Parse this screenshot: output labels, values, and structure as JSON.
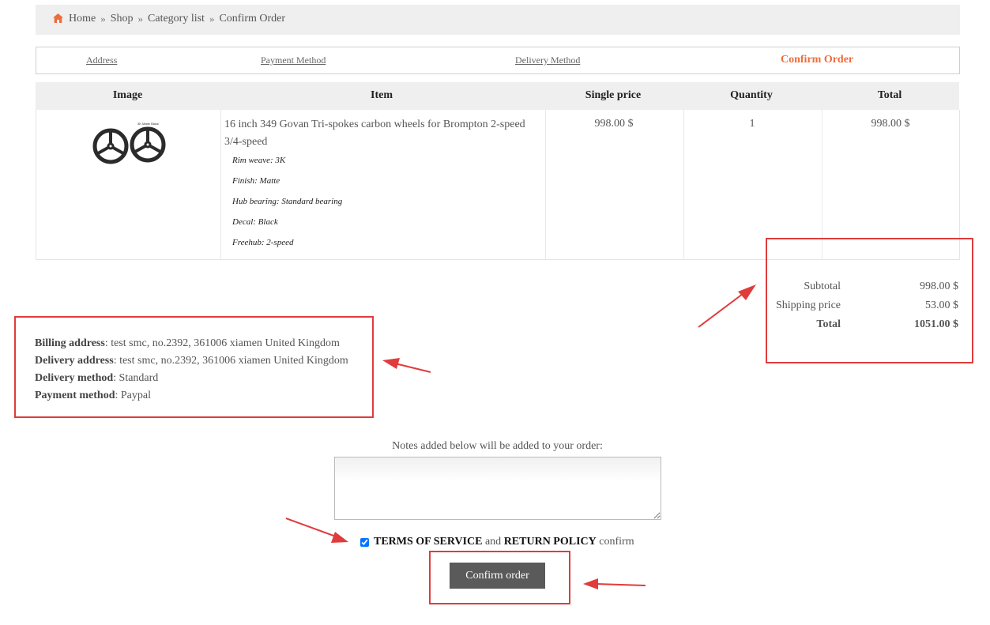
{
  "breadcrumb": {
    "items": [
      "Home",
      "Shop",
      "Category list",
      "Confirm Order"
    ],
    "separator": "»"
  },
  "steps": {
    "address": "Address",
    "payment": "Payment Method",
    "delivery": "Delivery Method",
    "confirm": "Confirm Order"
  },
  "table": {
    "headers": [
      "Image",
      "Item",
      "Single price",
      "Quantity",
      "Total"
    ],
    "row": {
      "image_caption": "3K Matte Black",
      "item_title": "16 inch 349 Govan Tri-spokes carbon wheels for Brompton 2-speed 3/4-speed",
      "options": [
        "Rim weave: 3K",
        "Finish: Matte",
        "Hub bearing: Standard bearing",
        "Decal: Black",
        "Freehub: 2-speed"
      ],
      "single_price": "998.00 $",
      "quantity": "1",
      "total": "998.00 $"
    }
  },
  "totals": {
    "subtotal_label": "Subtotal",
    "subtotal_value": "998.00 $",
    "shipping_label": "Shipping price",
    "shipping_value": "53.00 $",
    "total_label": "Total",
    "total_value": "1051.00 $"
  },
  "addresses": {
    "billing_label": "Billing address",
    "billing_value": ": test smc, no.2392, 361006 xiamen United Kingdom",
    "delivery_label": "Delivery address",
    "delivery_value": ": test smc, no.2392, 361006 xiamen United Kingdom",
    "delivery_method_label": "Delivery method",
    "delivery_method_value": ": Standard",
    "payment_method_label": "Payment method",
    "payment_method_value": ": Paypal"
  },
  "notes": {
    "label": "Notes added below will be added to your order:",
    "value": ""
  },
  "terms": {
    "checked": true,
    "tos": "TERMS OF SERVICE",
    "and": "and",
    "return_policy": "RETURN POLICY",
    "confirm": "confirm"
  },
  "confirm_button": "Confirm order",
  "colors": {
    "accent": "#ef6b3b",
    "annotation": "#e03c3c",
    "button": "#5a5a5a",
    "header_bg": "#efefef"
  }
}
